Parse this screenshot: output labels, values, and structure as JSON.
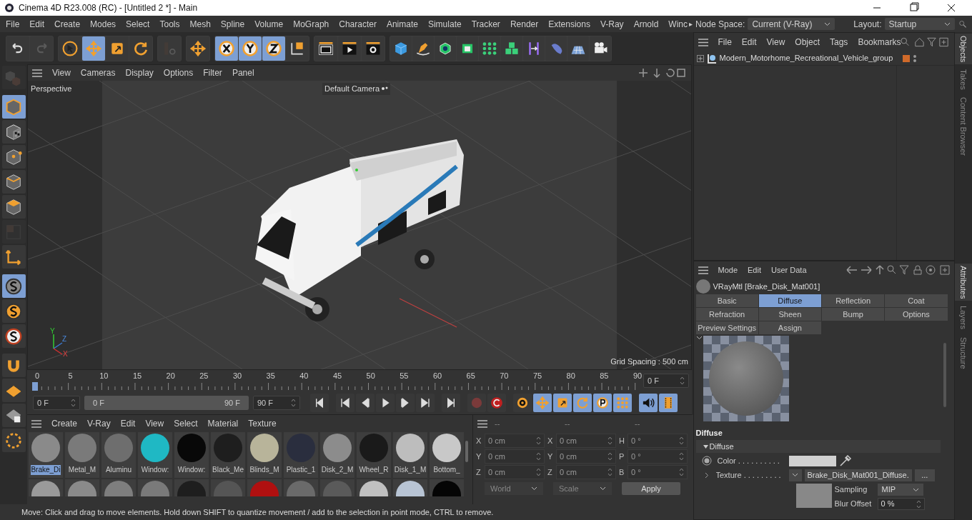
{
  "window": {
    "title": "Cinema 4D R23.008 (RC) - [Untitled 2 *] - Main"
  },
  "menu": [
    "File",
    "Edit",
    "Create",
    "Modes",
    "Select",
    "Tools",
    "Mesh",
    "Spline",
    "Volume",
    "MoGraph",
    "Character",
    "Animate",
    "Simulate",
    "Tracker",
    "Render",
    "Extensions",
    "V-Ray",
    "Arnold",
    "Winc"
  ],
  "menu_more": "▸",
  "node_space": {
    "label": "Node Space:",
    "value": "Current (V-Ray)"
  },
  "layout": {
    "label": "Layout:",
    "value": "Startup"
  },
  "toolbar": [
    {
      "kind": "undo",
      "selected": false,
      "disabled": false
    },
    {
      "kind": "redo",
      "selected": false,
      "disabled": true
    },
    {
      "kind": "select",
      "selected": false,
      "disabled": false
    },
    {
      "kind": "move",
      "selected": true,
      "disabled": false
    },
    {
      "kind": "scale",
      "selected": false,
      "disabled": false
    },
    {
      "kind": "rotate",
      "selected": false,
      "disabled": false
    },
    {
      "kind": "psr",
      "selected": false,
      "disabled": true
    },
    {
      "kind": "move",
      "selected": false,
      "disabled": false
    },
    {
      "kind": "x",
      "selected": true,
      "disabled": false
    },
    {
      "kind": "y",
      "selected": true,
      "disabled": false
    },
    {
      "kind": "z",
      "selected": true,
      "disabled": false
    },
    {
      "kind": "coord",
      "selected": false,
      "disabled": false
    },
    {
      "kind": "render-view",
      "selected": false,
      "disabled": false
    },
    {
      "kind": "render",
      "selected": false,
      "disabled": false
    },
    {
      "kind": "render-settings",
      "selected": false,
      "disabled": false
    },
    {
      "kind": "cube",
      "selected": false,
      "disabled": false
    },
    {
      "kind": "pen",
      "selected": false,
      "disabled": false
    },
    {
      "kind": "subdiv",
      "selected": false,
      "disabled": false
    },
    {
      "kind": "extrude",
      "selected": false,
      "disabled": false
    },
    {
      "kind": "cloner",
      "selected": false,
      "disabled": false
    },
    {
      "kind": "cubes",
      "selected": false,
      "disabled": false
    },
    {
      "kind": "bend",
      "selected": false,
      "disabled": false
    },
    {
      "kind": "capsule",
      "selected": false,
      "disabled": false
    },
    {
      "kind": "floor",
      "selected": false,
      "disabled": false
    },
    {
      "kind": "camera",
      "selected": false,
      "disabled": false
    }
  ],
  "left_toolbar": [
    {
      "kind": "make-editable",
      "selected": false,
      "disabled": true
    },
    {
      "kind": "model",
      "selected": true,
      "disabled": false
    },
    {
      "kind": "texture",
      "selected": false,
      "disabled": false
    },
    {
      "kind": "points",
      "selected": false,
      "disabled": false
    },
    {
      "kind": "edges",
      "selected": false,
      "disabled": false
    },
    {
      "kind": "polygons",
      "selected": false,
      "disabled": false
    },
    {
      "kind": "uv",
      "selected": false,
      "disabled": true
    },
    {
      "kind": "axis",
      "selected": false,
      "disabled": false
    },
    {
      "kind": "snap",
      "selected": true,
      "disabled": false
    },
    {
      "kind": "snap-orange",
      "selected": false,
      "disabled": false
    },
    {
      "kind": "snap-ring",
      "selected": false,
      "disabled": false
    },
    {
      "kind": "magnet",
      "selected": false,
      "disabled": false
    },
    {
      "kind": "workplane",
      "selected": false,
      "disabled": false
    },
    {
      "kind": "lock",
      "selected": false,
      "disabled": false
    },
    {
      "kind": "grid-snap",
      "selected": false,
      "disabled": false
    }
  ],
  "viewport": {
    "menu": [
      "View",
      "Cameras",
      "Display",
      "Options",
      "Filter",
      "Panel"
    ],
    "view_name": "Perspective",
    "camera": "Default Camera",
    "grid_spacing": "Grid Spacing : 500 cm",
    "axes": [
      "Y",
      "Z",
      "X"
    ]
  },
  "timeline": {
    "ticks": [
      "0",
      "5",
      "10",
      "15",
      "20",
      "25",
      "30",
      "35",
      "40",
      "45",
      "50",
      "55",
      "60",
      "65",
      "70",
      "75",
      "80",
      "85",
      "90"
    ],
    "playhead": {
      "level": 0
    },
    "current_frame": "0 F",
    "start": "0 F",
    "range_start": "0 F",
    "range": {
      "level": 1
    },
    "range_end": "90 F",
    "end": "90 F"
  },
  "playback": [
    {
      "kind": "key-start",
      "selected": false
    },
    {
      "kind": "first",
      "selected": false
    },
    {
      "kind": "prev",
      "selected": false
    },
    {
      "kind": "play",
      "selected": false
    },
    {
      "kind": "next",
      "selected": false
    },
    {
      "kind": "last",
      "selected": false
    },
    {
      "kind": "key-end",
      "selected": false
    },
    {
      "kind": "record-off",
      "selected": false
    },
    {
      "kind": "record",
      "selected": false
    },
    {
      "kind": "keyframe",
      "selected": false
    },
    {
      "kind": "move",
      "selected": true
    },
    {
      "kind": "scale",
      "selected": true
    },
    {
      "kind": "rotate",
      "selected": true
    },
    {
      "kind": "param",
      "selected": true
    },
    {
      "kind": "points-grid",
      "selected": true
    },
    {
      "kind": "sound",
      "selected": true
    },
    {
      "kind": "film",
      "selected": true
    }
  ],
  "materials": {
    "menu": [
      "Create",
      "V-Ray",
      "Edit",
      "View",
      "Select",
      "Material",
      "Texture"
    ],
    "items": [
      {
        "name": "Brake_Di",
        "color": "#8a8a8a",
        "selected": true
      },
      {
        "name": "Metal_M",
        "color": "#7a7a7a",
        "selected": false
      },
      {
        "name": "Aluminu",
        "color": "#6e6e6e",
        "selected": false
      },
      {
        "name": "Window:",
        "color": "#1fb8c4",
        "selected": false
      },
      {
        "name": "Window:",
        "color": "#080808",
        "selected": false
      },
      {
        "name": "Black_Me",
        "color": "#1e1e1e",
        "selected": false
      },
      {
        "name": "Blinds_M",
        "color": "#b8b49a",
        "selected": false
      },
      {
        "name": "Plastic_1",
        "color": "#2a2e3e",
        "selected": false
      },
      {
        "name": "Disk_2_M",
        "color": "#8c8c8c",
        "selected": false
      },
      {
        "name": "Wheel_R",
        "color": "#1a1a1a",
        "selected": false
      },
      {
        "name": "Disk_1_M",
        "color": "#bdbdbd",
        "selected": false
      },
      {
        "name": "Bottom_",
        "color": "#c8c8c8",
        "selected": false
      }
    ],
    "row_2": [
      {
        "color": "#9a9a9a"
      },
      {
        "color": "#8a8a8a"
      },
      {
        "color": "#7e7e7e"
      },
      {
        "color": "#7a7a7a"
      },
      {
        "color": "#1e1e1e"
      },
      {
        "color": "#555555"
      },
      {
        "color": "#b01010"
      },
      {
        "color": "#6a6a6a"
      },
      {
        "color": "#5a5a5a"
      },
      {
        "color": "#c0c0c0"
      },
      {
        "color": "#b8c4d4"
      },
      {
        "color": "#050505"
      }
    ]
  },
  "coordinates": {
    "headers": [
      "--",
      "--",
      "--"
    ],
    "rows": [
      [
        {
          "label": "X",
          "value": "0 cm"
        },
        {
          "label": "X",
          "value": "0 cm"
        },
        {
          "label": "H",
          "value": "0 °"
        }
      ],
      [
        {
          "label": "Y",
          "value": "0 cm"
        },
        {
          "label": "Y",
          "value": "0 cm"
        },
        {
          "label": "P",
          "value": "0 °"
        }
      ],
      [
        {
          "label": "Z",
          "value": "0 cm"
        },
        {
          "label": "Z",
          "value": "0 cm"
        },
        {
          "label": "B",
          "value": "0 °"
        }
      ]
    ],
    "space": "World",
    "mode": "Scale",
    "apply": "Apply"
  },
  "status_bar": "Move: Click and drag to move elements. Hold down SHIFT to quantize movement / add to the selection in point mode, CTRL to remove.",
  "objects": {
    "menu": [
      "File",
      "Edit",
      "View",
      "Object",
      "Tags",
      "Bookmarks"
    ],
    "items": [
      {
        "name": "Modern_Motorhome_Recreational_Vehicle_group",
        "color": "#d06a2a",
        "expanded": false
      }
    ]
  },
  "side_tabs_top": [
    {
      "label": "Objects",
      "selected": true
    },
    {
      "label": "Takes",
      "selected": false
    },
    {
      "label": "Content Browser",
      "selected": false
    }
  ],
  "side_tabs_bottom": [
    {
      "label": "Attributes",
      "selected": true
    },
    {
      "label": "Layers",
      "selected": false
    },
    {
      "label": "Structure",
      "selected": false
    }
  ],
  "attributes": {
    "menu": [
      "Mode",
      "Edit",
      "User Data"
    ],
    "title": "VRayMtl [Brake_Disk_Mat001]",
    "tabs": [
      {
        "label": "Basic",
        "selected": false
      },
      {
        "label": "Diffuse",
        "selected": true
      },
      {
        "label": "Reflection",
        "selected": false
      },
      {
        "label": "Coat",
        "selected": false
      },
      {
        "label": "Refraction",
        "selected": false
      },
      {
        "label": "Sheen",
        "selected": false
      },
      {
        "label": "Bump",
        "selected": false
      },
      {
        "label": "Options",
        "selected": false
      },
      {
        "label": "Preview Settings",
        "selected": false
      },
      {
        "label": "Assign",
        "selected": false
      }
    ],
    "section": "Diffuse",
    "group": {
      "label": "Diffuse",
      "expanded": true
    },
    "color_row": {
      "label": "Color . . . . . . . . . .",
      "color": "#d0d0d0"
    },
    "texture": {
      "label": "Texture . . . . . . . . .",
      "value": "Brake_Disk_Mat001_Diffuse.",
      "button": "..."
    },
    "sampling": {
      "label": "Sampling",
      "value": "MIP"
    },
    "blur_offset": {
      "label": "Blur Offset",
      "value": "0 %"
    }
  }
}
